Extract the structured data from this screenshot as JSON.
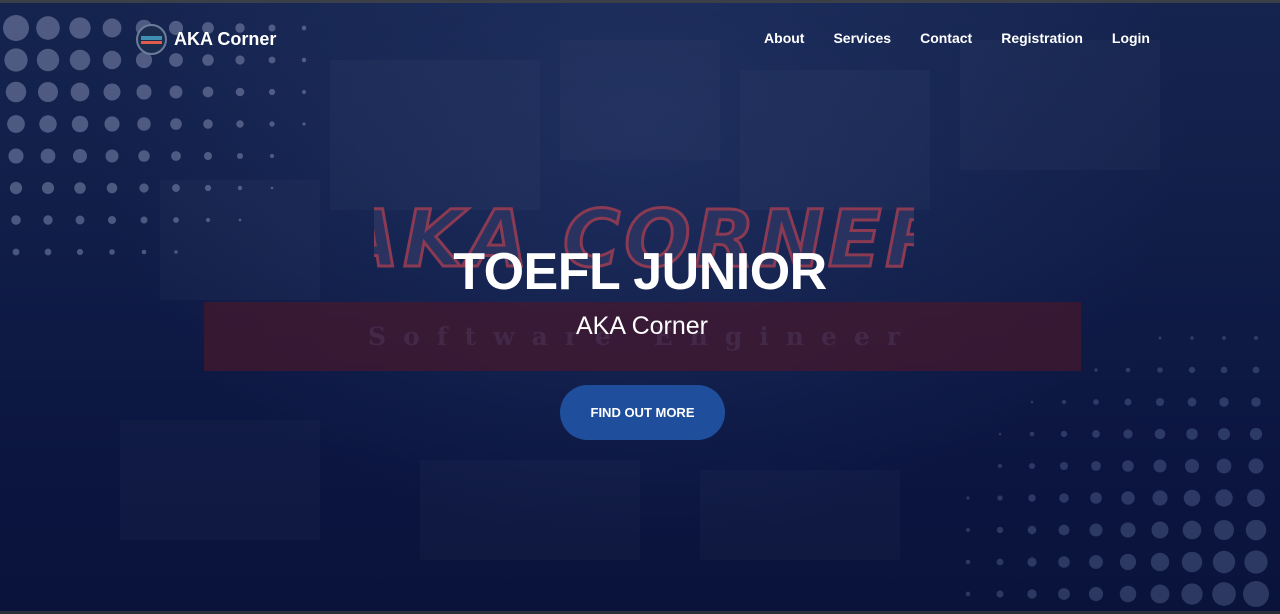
{
  "brand": {
    "name": "AKA Corner",
    "logo_icon": "aka-corner-logo-icon"
  },
  "nav": {
    "items": [
      "About",
      "Services",
      "Contact",
      "Registration",
      "Login"
    ]
  },
  "hero": {
    "watermark_text": "AKA CORNER",
    "ghost_subtitle": "Software Engineer",
    "title": "TOEFL JUNIOR",
    "subtitle": "AKA Corner",
    "cta_label": "FIND OUT MORE"
  },
  "colors": {
    "background": "#0c1639",
    "cta": "#1f4f9c",
    "band": "#46182c",
    "text": "#ffffff"
  }
}
